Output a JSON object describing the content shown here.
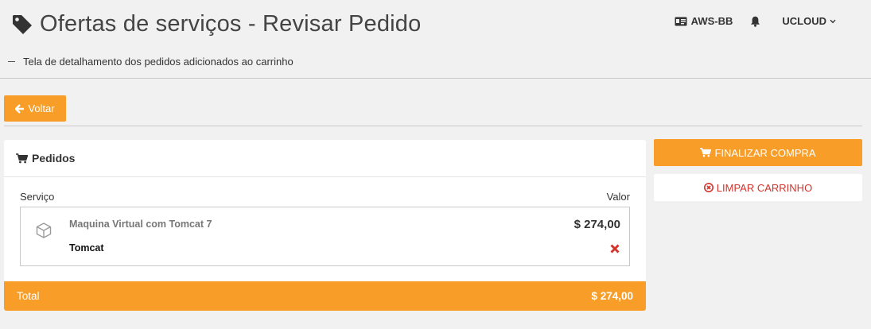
{
  "header": {
    "title": "Ofertas de serviços - Revisar Pedido",
    "subtitle": "Tela de detalhamento dos pedidos adicionados ao carrinho",
    "account": "AWS-BB",
    "user": "UCLOUD"
  },
  "actions": {
    "back_label": "Voltar",
    "finalize_label": "FINALIZAR COMPRA",
    "clear_label": "LIMPAR CARRINHO"
  },
  "orders": {
    "title": "Pedidos",
    "col_service": "Serviço",
    "col_value": "Valor",
    "items": [
      {
        "name": "Maquina Virtual com Tomcat 7",
        "sub": "Tomcat",
        "price": "$ 274,00"
      }
    ],
    "total_label": "Total",
    "total_value": "$ 274,00"
  },
  "colors": {
    "accent": "#f89d27",
    "danger": "#d0342c",
    "background": "#f1f1f1"
  },
  "icons": [
    "tag-icon",
    "id-card-icon",
    "bell-icon",
    "chevron-down-icon",
    "arrow-left-icon",
    "cart-icon",
    "cube-icon",
    "remove-icon",
    "times-circle-icon"
  ]
}
